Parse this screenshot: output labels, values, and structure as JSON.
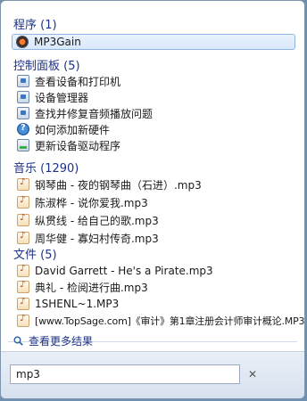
{
  "sections": {
    "programs": {
      "title": "程序 (1)",
      "items": [
        {
          "label": "MP3Gain",
          "icon": "app-icon"
        }
      ]
    },
    "control_panel": {
      "title": "控制面板 (5)",
      "items": [
        {
          "label": "查看设备和打印机",
          "icon": "devices-printers-icon"
        },
        {
          "label": "设备管理器",
          "icon": "device-manager-icon"
        },
        {
          "label": "查找并修复音频播放问题",
          "icon": "troubleshoot-icon"
        },
        {
          "label": "如何添加新硬件",
          "icon": "help-icon"
        },
        {
          "label": "更新设备驱动程序",
          "icon": "driver-update-icon"
        }
      ]
    },
    "music": {
      "title": "音乐 (1290)",
      "items": [
        {
          "label": "钢琴曲 - 夜的钢琴曲（石进）.mp3",
          "icon": "music-file-icon"
        },
        {
          "label": "陈淑桦 - 说你爱我.mp3",
          "icon": "music-file-icon"
        },
        {
          "label": "纵贯线 - 给自己的歌.mp3",
          "icon": "music-file-icon"
        },
        {
          "label": "周华健 - 寡妇村传奇.mp3",
          "icon": "music-file-icon"
        }
      ]
    },
    "files": {
      "title": "文件 (5)",
      "items": [
        {
          "label": "David Garrett - He's a Pirate.mp3",
          "icon": "audio-file-icon"
        },
        {
          "label": "典礼 - 检阅进行曲.mp3",
          "icon": "audio-file-icon"
        },
        {
          "label": "1SHENL~1.MP3",
          "icon": "audio-file-icon"
        },
        {
          "label": "[www.TopSage.com]《审计》第1章注册会计师审计概论.MP3",
          "icon": "audio-file-icon"
        }
      ]
    }
  },
  "more_results": {
    "label": "查看更多结果",
    "icon": "search-icon"
  },
  "search": {
    "value": "mp3",
    "clear_glyph": "✕"
  }
}
